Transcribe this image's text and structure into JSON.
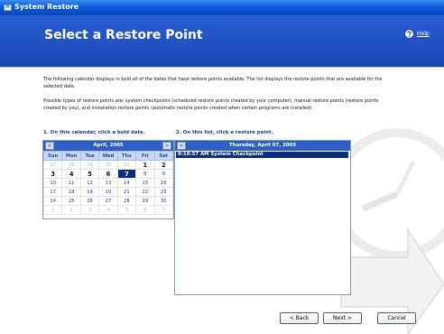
{
  "window": {
    "title": "System Restore"
  },
  "header": {
    "title": "Select a Restore Point",
    "help_label": "Help"
  },
  "intro": {
    "paragraph1": "The following calendar displays in bold all of the dates that have restore points available. The list displays the restore points that are available for the selected date.",
    "paragraph2": "Possible types of restore points are: system checkpoints (scheduled restore points created by your computer), manual restore points (restore points created by you), and installation restore points (automatic restore points created when certain programs are installed)."
  },
  "steps": {
    "step1": "1. On this calendar, click a bold date.",
    "step2": "2. On this list, click a restore point."
  },
  "calendar": {
    "month_label": "April, 2005",
    "prev_glyph": "<",
    "next_glyph": ">",
    "weekdays": [
      "Sun",
      "Mon",
      "Tue",
      "Wed",
      "Thu",
      "Fri",
      "Sat"
    ],
    "weeks": [
      [
        {
          "d": "27",
          "t": "other"
        },
        {
          "d": "28",
          "t": "other"
        },
        {
          "d": "29",
          "t": "other"
        },
        {
          "d": "30",
          "t": "other"
        },
        {
          "d": "31",
          "t": "other"
        },
        {
          "d": "1",
          "t": "bold"
        },
        {
          "d": "2",
          "t": "bold"
        }
      ],
      [
        {
          "d": "3",
          "t": "bold"
        },
        {
          "d": "4",
          "t": "bold"
        },
        {
          "d": "5",
          "t": "bold"
        },
        {
          "d": "6",
          "t": "bold"
        },
        {
          "d": "7",
          "t": "sel"
        },
        {
          "d": "8",
          "t": ""
        },
        {
          "d": "9",
          "t": ""
        }
      ],
      [
        {
          "d": "10",
          "t": ""
        },
        {
          "d": "11",
          "t": ""
        },
        {
          "d": "12",
          "t": ""
        },
        {
          "d": "13",
          "t": ""
        },
        {
          "d": "14",
          "t": ""
        },
        {
          "d": "15",
          "t": ""
        },
        {
          "d": "16",
          "t": ""
        }
      ],
      [
        {
          "d": "17",
          "t": ""
        },
        {
          "d": "18",
          "t": ""
        },
        {
          "d": "19",
          "t": ""
        },
        {
          "d": "20",
          "t": ""
        },
        {
          "d": "21",
          "t": ""
        },
        {
          "d": "22",
          "t": ""
        },
        {
          "d": "23",
          "t": ""
        }
      ],
      [
        {
          "d": "24",
          "t": ""
        },
        {
          "d": "25",
          "t": ""
        },
        {
          "d": "26",
          "t": ""
        },
        {
          "d": "27",
          "t": ""
        },
        {
          "d": "28",
          "t": ""
        },
        {
          "d": "29",
          "t": ""
        },
        {
          "d": "30",
          "t": ""
        }
      ],
      [
        {
          "d": "1",
          "t": "other"
        },
        {
          "d": "2",
          "t": "other"
        },
        {
          "d": "3",
          "t": "other"
        },
        {
          "d": "4",
          "t": "other"
        },
        {
          "d": "5",
          "t": "other"
        },
        {
          "d": "6",
          "t": "other"
        },
        {
          "d": "7",
          "t": "other"
        }
      ]
    ]
  },
  "restore_list": {
    "date_label": "Thursday, April 07, 2005",
    "prev_glyph": "<",
    "selected_item": "9:18:57 AM  System Checkpoint"
  },
  "buttons": {
    "back": "< Back",
    "next": "Next >",
    "cancel": "Cancel"
  },
  "colors": {
    "header_blue": "#1e4fc0",
    "selection": "#0b2d7d",
    "title_bar": "#0a5bd8"
  }
}
